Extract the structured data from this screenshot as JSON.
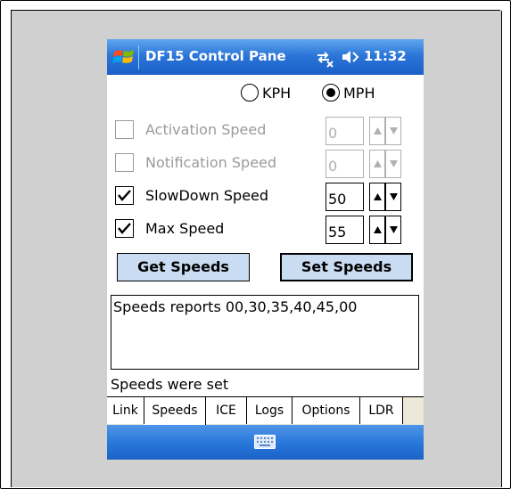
{
  "titlebar": {
    "title": "DF15 Control Pane",
    "time": "11:32",
    "icons": [
      "windows-start-logo",
      "connectivity-icon",
      "volume-muted-icon"
    ]
  },
  "units": {
    "kph_label": "KPH",
    "mph_label": "MPH",
    "selected": "MPH"
  },
  "settings": [
    {
      "label": "Activation Speed",
      "checked": false,
      "enabled": false,
      "value": "0"
    },
    {
      "label": "Notification Speed",
      "checked": false,
      "enabled": false,
      "value": "0"
    },
    {
      "label": "SlowDown Speed",
      "checked": true,
      "enabled": true,
      "value": "50"
    },
    {
      "label": "Max Speed",
      "checked": true,
      "enabled": true,
      "value": "55"
    }
  ],
  "buttons": {
    "get_speeds": "Get Speeds",
    "set_speeds": "Set Speeds"
  },
  "report_text": "Speeds reports 00,30,35,40,45,00",
  "status_text": "Speeds were set",
  "tabs": [
    {
      "label": "Link"
    },
    {
      "label": "Speeds",
      "active": true
    },
    {
      "label": "ICE"
    },
    {
      "label": "Logs"
    },
    {
      "label": "Options"
    },
    {
      "label": "LDR"
    }
  ],
  "menubar": {
    "icon": "keyboard-icon"
  },
  "colors": {
    "titlebar_blue": "#2b76d8",
    "button_fill": "#c9dcf2",
    "panel_gray": "#d0d0d0"
  }
}
